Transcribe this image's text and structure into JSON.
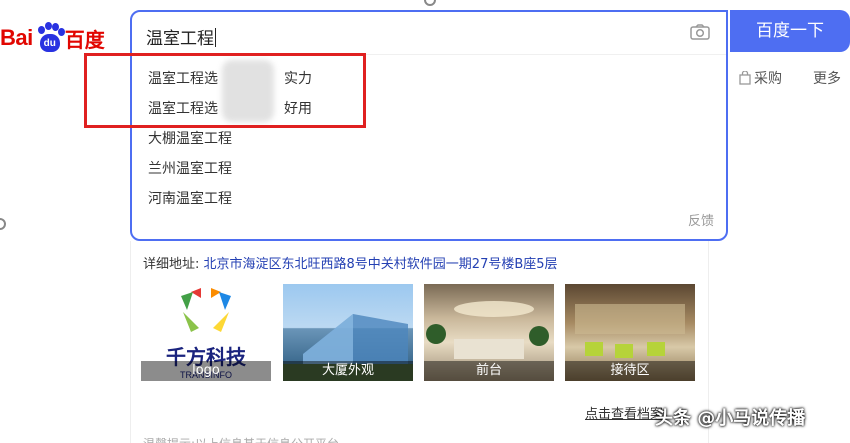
{
  "logo": {
    "latin": "Bai",
    "pad": "du",
    "cn": "百度"
  },
  "search": {
    "query": "温室工程",
    "button_label": "百度一下",
    "suggestions": [
      {
        "prefix": "温室工程选",
        "suffix": "实力"
      },
      {
        "prefix": "温室工程选",
        "suffix": "好用"
      },
      {
        "text": "大棚温室工程"
      },
      {
        "text": "兰州温室工程"
      },
      {
        "text": "河南温室工程"
      }
    ],
    "feedback_label": "反馈"
  },
  "tabs": {
    "purchase": "采购",
    "more": "更多"
  },
  "result": {
    "address_label": "详细地址:",
    "address_value": "北京市海淀区东北旺西路8号中关村软件园一期27号楼B座5层",
    "photos": [
      {
        "caption": "logo"
      },
      {
        "caption": "大厦外观"
      },
      {
        "caption": "前台"
      },
      {
        "caption": "接待区"
      }
    ],
    "logo_text": "千方科技",
    "logo_sub": "TRANSINFO",
    "more_archive": "点击查看档案",
    "bottom_text": "温馨提示:以上信息基于信息公开平台"
  },
  "watermark": "头条 @小马说传播",
  "colors": {
    "accent": "#4e6ef2",
    "brand_red": "#e10601",
    "highlight_box": "#e02020",
    "link": "#2440b3"
  }
}
